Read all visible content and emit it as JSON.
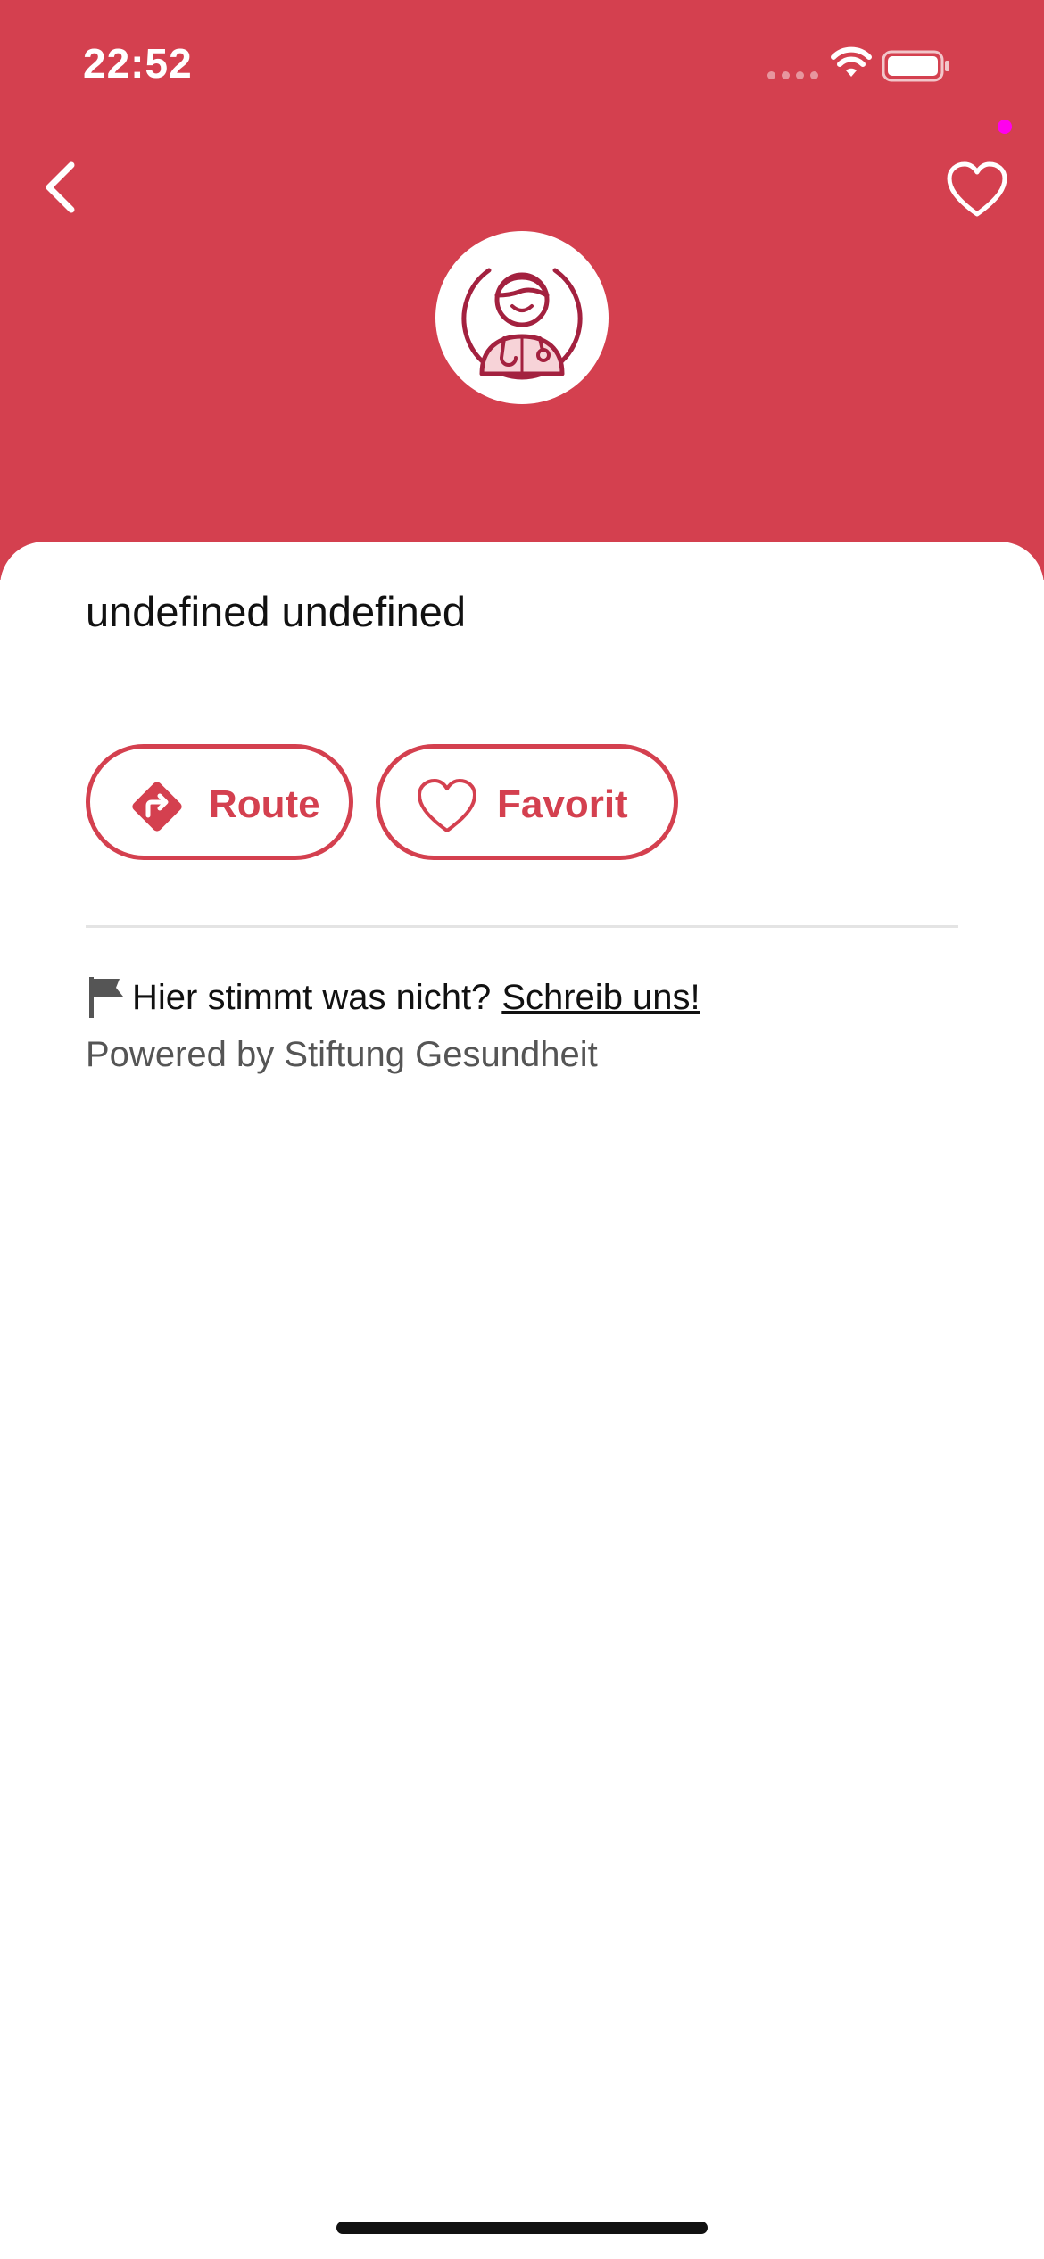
{
  "status_bar": {
    "time": "22:52",
    "icons": [
      "signal-icon",
      "wifi-icon",
      "battery-icon"
    ]
  },
  "header": {
    "background_color": "#d4404f",
    "back_icon": "chevron-left-icon",
    "favorite_icon": "heart-outline-icon",
    "avatar_icon": "doctor-avatar-icon"
  },
  "detail": {
    "name": "undefined undefined"
  },
  "actions": {
    "route_label": "Route",
    "route_icon": "directions-icon",
    "favorite_label": "Favorit",
    "favorite_icon": "heart-outline-icon",
    "accent_color": "#d4404f"
  },
  "report": {
    "icon": "flag-icon",
    "text": "Hier stimmt was nicht?",
    "link_label": "Schreib uns!"
  },
  "footer": {
    "powered_by": "Powered by Stiftung Gesundheit"
  }
}
